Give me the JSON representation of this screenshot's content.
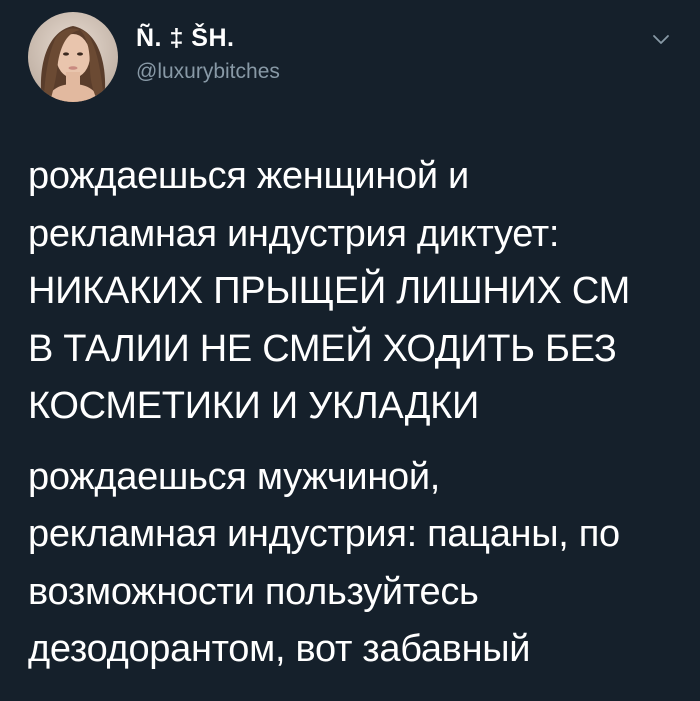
{
  "author": {
    "display_name": "Ñ. ‡ ŠH.",
    "handle": "@luxurybitches",
    "avatar_icon": "user-avatar",
    "menu_icon": "chevron-down-icon"
  },
  "tweet": {
    "paragraphs": [
      {
        "lines": [
          "рождаешься женщиной и",
          "рекламная индустрия диктует:",
          "НИКАКИХ ПРЫЩЕЙ ЛИШНИХ СМ",
          "В ТАЛИИ НЕ СМЕЙ ХОДИТЬ БЕЗ",
          "КОСМЕТИКИ И УКЛАДКИ"
        ]
      },
      {
        "lines": [
          "рождаешься мужчиной,",
          "рекламная индустрия: пацаны, по",
          "возможности пользуйтесь",
          "дезодорантом, вот забавный"
        ]
      }
    ]
  },
  "colors": {
    "background": "#15202b",
    "text": "#ffffff",
    "secondary_text": "#8899a6"
  }
}
